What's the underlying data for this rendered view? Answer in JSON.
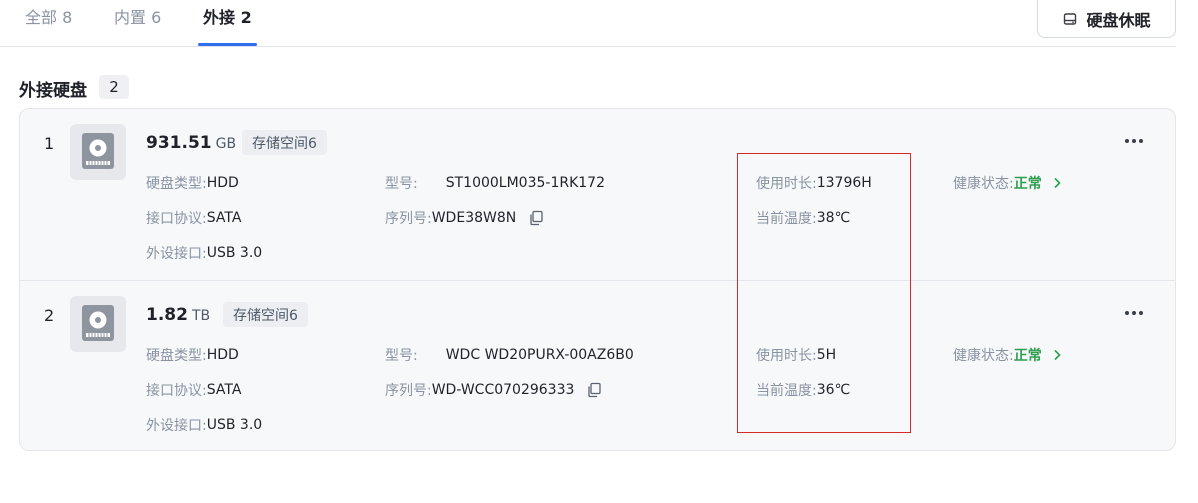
{
  "tabs": [
    {
      "label": "全部 8"
    },
    {
      "label": "内置 6"
    },
    {
      "label": "外接 2"
    }
  ],
  "sleep_button": {
    "label": "硬盘休眠",
    "icon": "disk-sleep-icon"
  },
  "section": {
    "title": "外接硬盘",
    "count": "2"
  },
  "disks": [
    {
      "index": "1",
      "size_value": "931.51",
      "size_unit": "GB",
      "pool": "存储空间6",
      "type_label": "硬盘类型:",
      "type_value": "HDD",
      "interface_label": "接口协议:",
      "interface_value": "SATA",
      "port_label": "外设接口:",
      "port_value": "USB 3.0",
      "model_label": "型号:",
      "model_value": "ST1000LM035-1RK172",
      "serial_label": "序列号:",
      "serial_value": "WDE38W8N",
      "uptime_label": "使用时长:",
      "uptime_value": "13796H",
      "temp_label": "当前温度:",
      "temp_value": "38℃",
      "health_label": "健康状态:",
      "health_value": "正常"
    },
    {
      "index": "2",
      "size_value": "1.82",
      "size_unit": "TB",
      "pool": "存储空间6",
      "type_label": "硬盘类型:",
      "type_value": "HDD",
      "interface_label": "接口协议:",
      "interface_value": "SATA",
      "port_label": "外设接口:",
      "port_value": "USB 3.0",
      "model_label": "型号:",
      "model_value": "WDC WD20PURX-00AZ6B0",
      "serial_label": "序列号:",
      "serial_value": "WD-WCC070296333",
      "uptime_label": "使用时长:",
      "uptime_value": "5H",
      "temp_label": "当前温度:",
      "temp_value": "36℃",
      "health_label": "健康状态:",
      "health_value": "正常"
    }
  ],
  "colors": {
    "accent": "#2f6fed",
    "health_ok": "#2e9e4f",
    "highlight": "#d42a2a"
  }
}
